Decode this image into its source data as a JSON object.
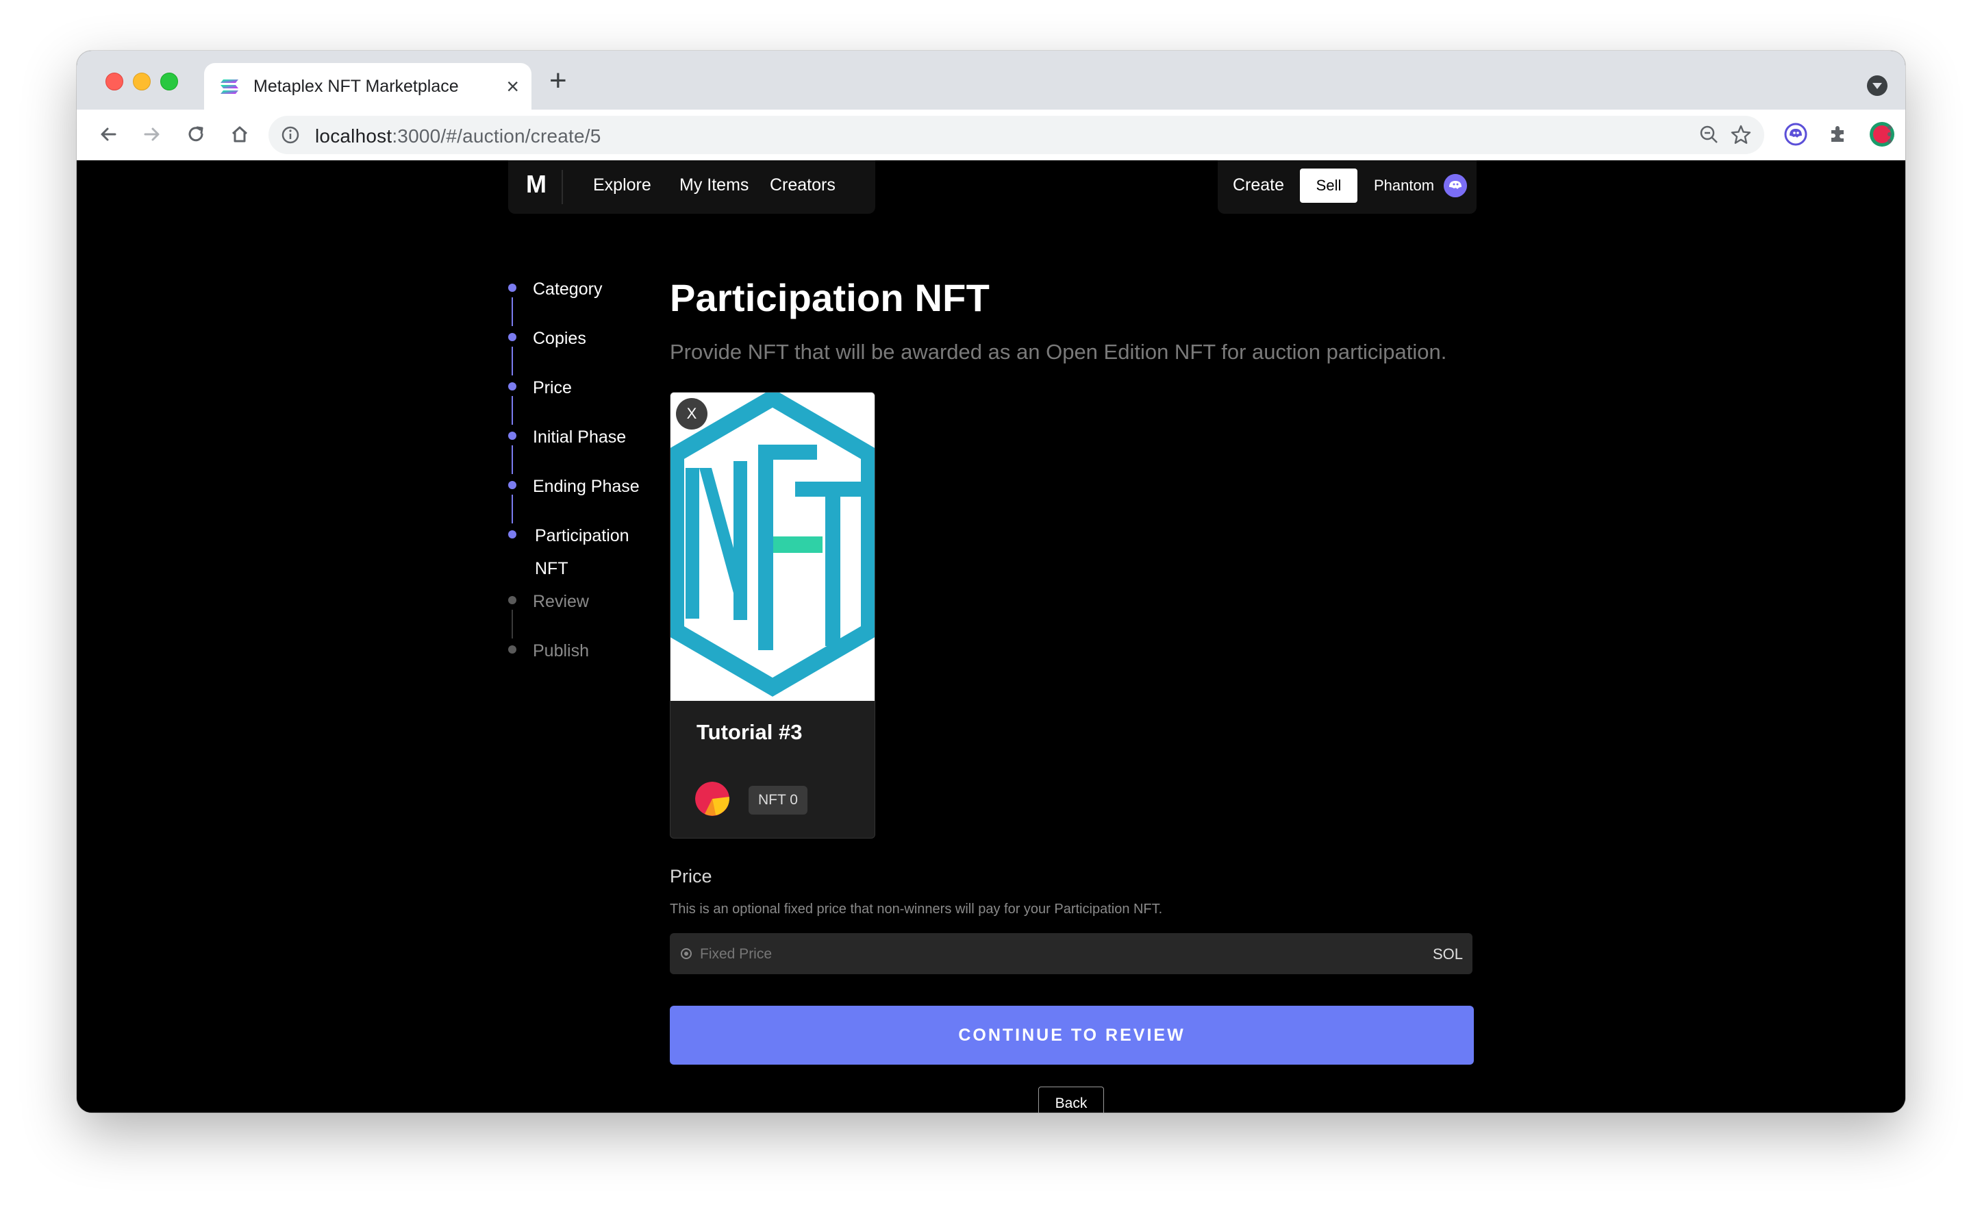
{
  "browser": {
    "tab_title": "Metaplex NFT Marketplace",
    "tab_close": "×",
    "new_tab": "+",
    "url_host": "localhost",
    "url_path": ":3000/#/auction/create/5"
  },
  "topnav": {
    "logo": "M",
    "links": [
      "Explore",
      "My Items",
      "Creators"
    ],
    "create": "Create",
    "sell": "Sell",
    "wallet": "Phantom"
  },
  "steps": [
    {
      "label": "Category",
      "state": "done"
    },
    {
      "label": "Copies",
      "state": "done"
    },
    {
      "label": "Price",
      "state": "done"
    },
    {
      "label": "Initial Phase",
      "state": "done"
    },
    {
      "label": "Ending Phase",
      "state": "done"
    },
    {
      "label_line1": "Participation",
      "label_line2": "NFT",
      "state": "current"
    },
    {
      "label": "Review",
      "state": "upcoming"
    },
    {
      "label": "Publish",
      "state": "upcoming"
    }
  ],
  "main": {
    "title": "Participation NFT",
    "subtitle": "Provide NFT that will be awarded as an Open Edition NFT for auction participation.",
    "card": {
      "remove": "X",
      "image_text": "NFT",
      "name": "Tutorial #3",
      "badge": "NFT 0"
    },
    "price": {
      "label": "Price",
      "help": "This is an optional fixed price that non-winners will pay for your Participation NFT.",
      "placeholder": "Fixed Price",
      "value": "",
      "suffix": "SOL"
    },
    "continue_label": "CONTINUE TO REVIEW",
    "back_label": "Back"
  },
  "colors": {
    "accent": "#6b7cf6",
    "step_active": "#7b7cf0",
    "page_bg": "#000000",
    "card_bg": "#1e1e1e",
    "nft_teal": "#23a9c8",
    "nft_green": "#2fd1a6"
  }
}
